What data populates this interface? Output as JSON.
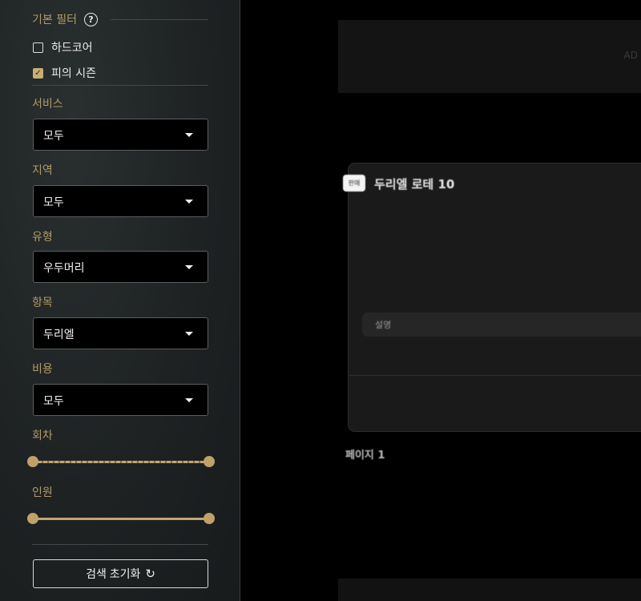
{
  "sidebar": {
    "filter_title": "기본 필터",
    "help_icon": "?",
    "checkboxes": [
      {
        "label": "하드코어",
        "checked": false
      },
      {
        "label": "피의 시즌",
        "checked": true
      }
    ],
    "selects": [
      {
        "label": "서비스",
        "value": "모두"
      },
      {
        "label": "지역",
        "value": "모두"
      },
      {
        "label": "유형",
        "value": "우두머리"
      },
      {
        "label": "항목",
        "value": "두리엘"
      },
      {
        "label": "비용",
        "value": "모두"
      }
    ],
    "sliders": [
      {
        "label": "회차"
      },
      {
        "label": "인원"
      }
    ],
    "reset_label": "검색 초기화",
    "reset_icon": "refresh-icon"
  },
  "main": {
    "ad_text": "AD",
    "card": {
      "badge": "판매",
      "title": "두리엘 로테 10",
      "description_label": "설명"
    },
    "page_label": "페이지 1"
  },
  "colors": {
    "accent": "#b39a66",
    "slider": "#c2a66e",
    "background": "#000000",
    "sidebar": "#1e2223"
  }
}
